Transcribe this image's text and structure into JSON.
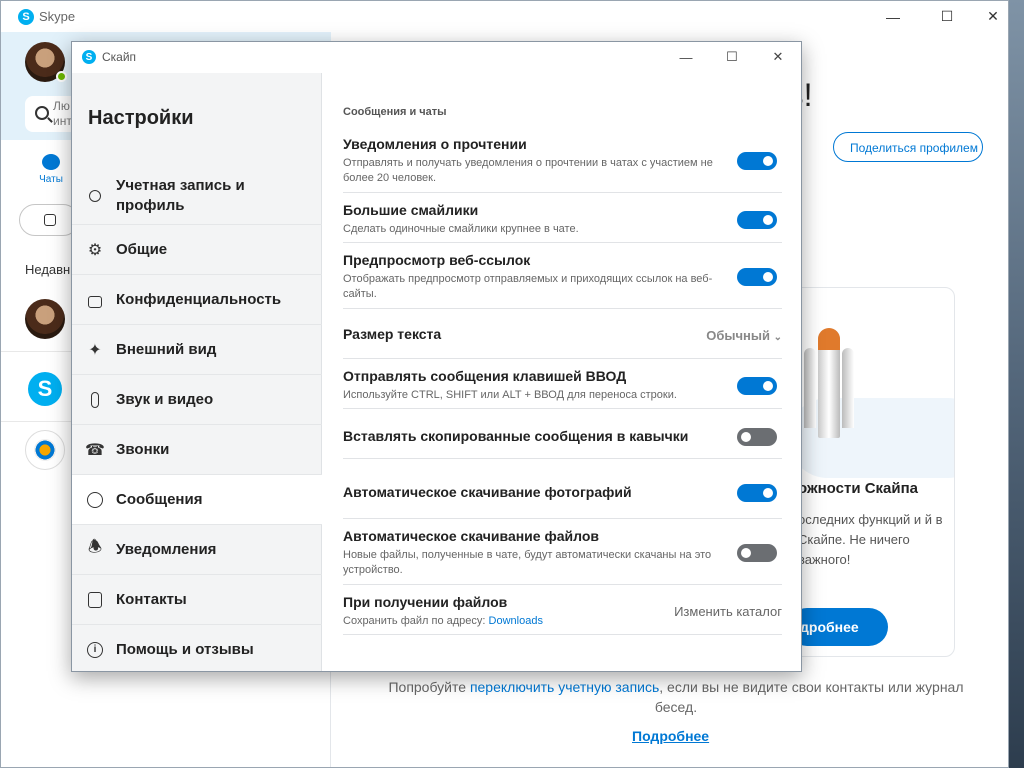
{
  "main": {
    "title": "Skype",
    "search_placeholder": "Лю инт",
    "chats_label": "Чаты",
    "recent_label": "Недавн",
    "welcome": "ь!",
    "share_button": "Поделиться профилем",
    "card_title": "ожности Скайпа",
    "card_text": "оследних функций и й в Скайпе. Не ничего важного!",
    "card_button": "дробнее",
    "bottom_text_1": "Попробуйте ",
    "bottom_link": "переключить учетную запись",
    "bottom_text_2": ", если вы не видите свои контакты или журнал бесед.",
    "bottom_more": "Подробнее"
  },
  "dialog": {
    "title": "Скайп",
    "heading": "Настройки",
    "nav": [
      {
        "label": "Учетная запись и профиль",
        "icon": "person-icon"
      },
      {
        "label": "Общие",
        "icon": "gear-icon"
      },
      {
        "label": "Конфиденциальность",
        "icon": "lock-icon"
      },
      {
        "label": "Внешний вид",
        "icon": "magic-wand-icon"
      },
      {
        "label": "Звук и видео",
        "icon": "microphone-icon"
      },
      {
        "label": "Звонки",
        "icon": "phone-icon"
      },
      {
        "label": "Сообщения",
        "icon": "chat-icon",
        "active": true
      },
      {
        "label": "Уведомления",
        "icon": "bell-icon"
      },
      {
        "label": "Контакты",
        "icon": "contacts-icon"
      },
      {
        "label": "Помощь и отзывы",
        "icon": "info-icon"
      }
    ],
    "section_title": "Сообщения и чаты",
    "settings": {
      "read_receipts": {
        "title": "Уведомления о прочтении",
        "desc": "Отправлять и получать уведомления о прочтении в чатах с участием не более 20 человек.",
        "on": true
      },
      "big_emoji": {
        "title": "Большие смайлики",
        "desc": "Сделать одиночные смайлики крупнее в чате.",
        "on": true
      },
      "link_preview": {
        "title": "Предпросмотр веб-ссылок",
        "desc": "Отображать предпросмотр отправляемых и приходящих ссылок на веб-сайты.",
        "on": true
      },
      "text_size": {
        "title": "Размер текста",
        "value": "Обычный"
      },
      "enter_send": {
        "title": "Отправлять сообщения клавишей ВВОД",
        "desc": "Используйте CTRL, SHIFT или ALT + ВВОД для переноса строки.",
        "on": true
      },
      "paste_quotes": {
        "title": "Вставлять скопированные сообщения в кавычки",
        "on": false
      },
      "auto_photos": {
        "title": "Автоматическое скачивание фотографий",
        "on": true
      },
      "auto_files": {
        "title": "Автоматическое скачивание файлов",
        "desc": "Новые файлы, полученные в чате, будут автоматически скачаны на это устройство.",
        "on": false
      },
      "receive_files": {
        "title": "При получении файлов",
        "desc": "Сохранить файл по адресу: ",
        "link": "Downloads",
        "action": "Изменить каталог"
      }
    }
  }
}
